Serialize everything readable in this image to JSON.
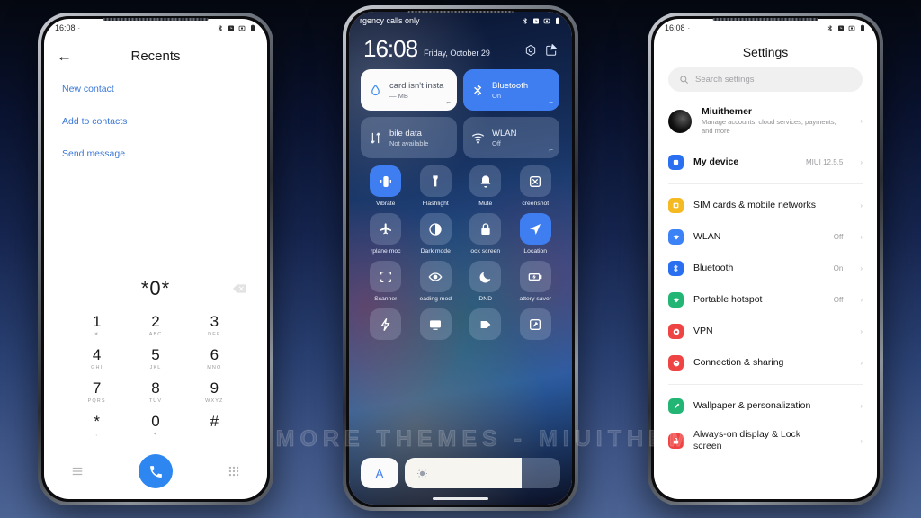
{
  "background": {
    "gradient_top": "#050810",
    "gradient_bottom": "#4c6494"
  },
  "watermark": {
    "text": "VISIT  FOR  MORE  THEMES  -  MIUITHEMER.COM"
  },
  "phone1": {
    "status_bar": {
      "time": "16:08",
      "dot": "·",
      "icons": [
        "bluetooth-icon",
        "alarm-icon",
        "vibrate-icon",
        "battery-icon"
      ]
    },
    "appbar": {
      "back_label": "←",
      "title": "Recents"
    },
    "links": [
      {
        "label": "New contact"
      },
      {
        "label": "Add to contacts"
      },
      {
        "label": "Send message"
      }
    ],
    "dial_input": {
      "value": "*0*",
      "delete_icon": "backspace-icon"
    },
    "keypad": [
      {
        "digit": "1",
        "letters": "☀"
      },
      {
        "digit": "2",
        "letters": "ABC"
      },
      {
        "digit": "3",
        "letters": "DEF"
      },
      {
        "digit": "4",
        "letters": "GHI"
      },
      {
        "digit": "5",
        "letters": "JKL"
      },
      {
        "digit": "6",
        "letters": "MNO"
      },
      {
        "digit": "7",
        "letters": "PQRS"
      },
      {
        "digit": "8",
        "letters": "TUV"
      },
      {
        "digit": "9",
        "letters": "WXYZ"
      },
      {
        "digit": "*",
        "letters": ","
      },
      {
        "digit": "0",
        "letters": "+"
      },
      {
        "digit": "#",
        "letters": ""
      }
    ],
    "bottom_bar": {
      "left_icon": "menu-icon",
      "call_icon": "phone-call-icon",
      "right_icon": "keypad-icon",
      "call_color": "#2e86f0"
    }
  },
  "phone2": {
    "status_bar": {
      "carrier": "rgency calls only",
      "icons": [
        "bluetooth-icon",
        "alarm-icon",
        "vibrate-icon",
        "battery-icon"
      ]
    },
    "header": {
      "clock": "16:08",
      "date": "Friday, October 29",
      "settings_icon": "gear-hex-icon",
      "edit_icon": "edit-square-icon"
    },
    "big_tiles": [
      {
        "title": "card isn't insta",
        "subtitle": "— MB",
        "icon": "water-drop-icon",
        "state": "white",
        "corner": "expand-arrow-icon"
      },
      {
        "title": "Bluetooth",
        "subtitle": "On",
        "icon": "bluetooth-icon",
        "state": "active",
        "corner": "expand-arrow-icon"
      },
      {
        "title": "bile data",
        "subtitle": "Not available",
        "icon": "data-arrows-icon",
        "state": "dim",
        "corner": ""
      },
      {
        "title": "WLAN",
        "subtitle": "Off",
        "icon": "wifi-icon",
        "state": "dim",
        "corner": "expand-arrow-icon"
      }
    ],
    "tiles": [
      {
        "label": "Vibrate",
        "icon": "vibrate-icon",
        "on": true
      },
      {
        "label": "Flashlight",
        "icon": "flashlight-icon",
        "on": false
      },
      {
        "label": "Mute",
        "icon": "bell-icon",
        "on": false
      },
      {
        "label": "creenshot",
        "icon": "screenshot-icon",
        "on": false
      },
      {
        "label": "rplane moc",
        "icon": "airplane-icon",
        "on": false
      },
      {
        "label": "Dark mode",
        "icon": "contrast-icon",
        "on": false
      },
      {
        "label": "ock screen",
        "icon": "lock-icon",
        "on": false
      },
      {
        "label": "Location",
        "icon": "location-arrow-icon",
        "on": true
      },
      {
        "label": "Scanner",
        "icon": "scan-frame-icon",
        "on": false
      },
      {
        "label": "eading mod",
        "icon": "eye-icon",
        "on": false
      },
      {
        "label": "DND",
        "icon": "moon-icon",
        "on": false
      },
      {
        "label": "attery saver",
        "icon": "battery-saver-icon",
        "on": false
      },
      {
        "label": "",
        "icon": "lightning-icon",
        "on": false
      },
      {
        "label": "",
        "icon": "cast-screen-icon",
        "on": false
      },
      {
        "label": "",
        "icon": "reading-card-icon",
        "on": false
      },
      {
        "label": "",
        "icon": "resize-icon",
        "on": false
      }
    ],
    "brightness": {
      "auto_label": "A",
      "icon": "sun-icon",
      "percent": 75
    }
  },
  "phone3": {
    "status_bar": {
      "time": "16:08",
      "dot": "·",
      "icons": [
        "bluetooth-icon",
        "alarm-icon",
        "vibrate-icon",
        "battery-icon"
      ]
    },
    "title": "Settings",
    "search": {
      "placeholder": "Search settings",
      "icon": "search-icon"
    },
    "account": {
      "name": "Miuithemer",
      "subtitle": "Manage accounts, cloud services, payments, and more",
      "chevron": "›"
    },
    "rows": [
      {
        "label": "My device",
        "value": "MIUI 12.5.5",
        "icon": "device-icon",
        "color": "#2a6ff0",
        "bold": true,
        "divider_after": true
      },
      {
        "label": "SIM cards & mobile networks",
        "value": "",
        "icon": "sim-icon",
        "color": "#f5b921",
        "bold": false
      },
      {
        "label": "WLAN",
        "value": "Off",
        "icon": "wifi-icon",
        "color": "#3b82f6",
        "bold": false
      },
      {
        "label": "Bluetooth",
        "value": "On",
        "icon": "bluetooth-icon",
        "color": "#2a6ff0",
        "bold": false
      },
      {
        "label": "Portable hotspot",
        "value": "Off",
        "icon": "hotspot-icon",
        "color": "#22b573",
        "bold": false
      },
      {
        "label": "VPN",
        "value": "",
        "icon": "vpn-icon",
        "color": "#ef4444",
        "bold": false
      },
      {
        "label": "Connection & sharing",
        "value": "",
        "icon": "sharing-icon",
        "color": "#ef4444",
        "bold": false,
        "divider_after": true
      },
      {
        "label": "Wallpaper & personalization",
        "value": "",
        "icon": "wallpaper-icon",
        "color": "#22b573",
        "bold": false
      },
      {
        "label": "Always-on display & Lock screen",
        "value": "",
        "icon": "lockscreen-icon",
        "color": "#ef4444",
        "bold": false
      }
    ]
  }
}
